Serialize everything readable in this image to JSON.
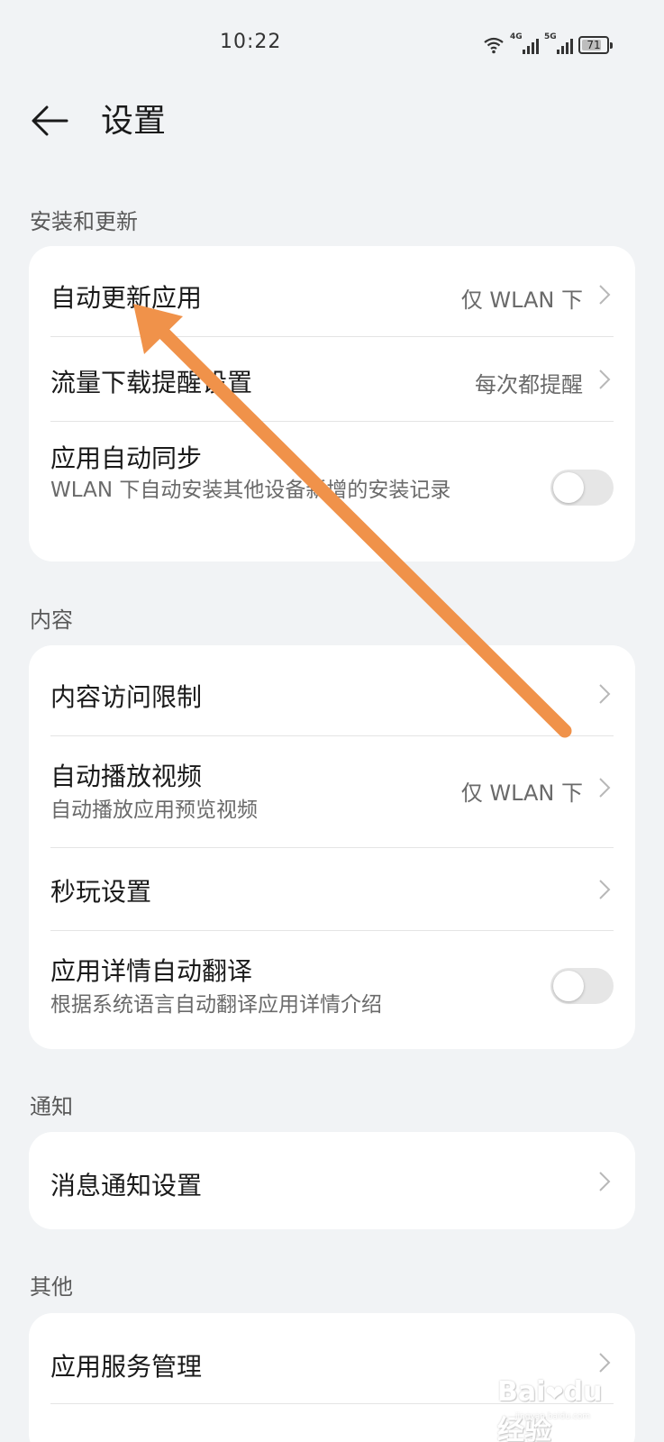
{
  "status_bar": {
    "time": "10:22",
    "network_1": "4G",
    "network_2": "5G",
    "battery": "71"
  },
  "header": {
    "back_icon": "back-arrow-icon",
    "title": "设置"
  },
  "sections": {
    "install": {
      "label": "安装和更新",
      "auto_update": {
        "title": "自动更新应用",
        "value": "仅 WLAN 下"
      },
      "traffic_reminder": {
        "title": "流量下载提醒设置",
        "value": "每次都提醒"
      },
      "auto_sync": {
        "title": "应用自动同步",
        "subtitle": "WLAN 下自动安装其他设备新增的安装记录",
        "enabled": false
      }
    },
    "content": {
      "label": "内容",
      "access_limit": {
        "title": "内容访问限制"
      },
      "autoplay": {
        "title": "自动播放视频",
        "subtitle": "自动播放应用预览视频",
        "value": "仅 WLAN 下"
      },
      "instant_play": {
        "title": "秒玩设置"
      },
      "auto_translate": {
        "title": "应用详情自动翻译",
        "subtitle": "根据系统语言自动翻译应用详情介绍",
        "enabled": false
      }
    },
    "notification": {
      "label": "通知",
      "message_settings": {
        "title": "消息通知设置"
      }
    },
    "other": {
      "label": "其他",
      "service_management": {
        "title": "应用服务管理"
      }
    }
  },
  "annotation": {
    "arrow_color": "#f0924a"
  },
  "watermark": {
    "text": "Bai du 经验",
    "sub": "jingyan.baidu.com"
  },
  "colors": {
    "background": "#f1f3f5",
    "card": "#ffffff",
    "secondary_text": "#6a6a6a"
  }
}
